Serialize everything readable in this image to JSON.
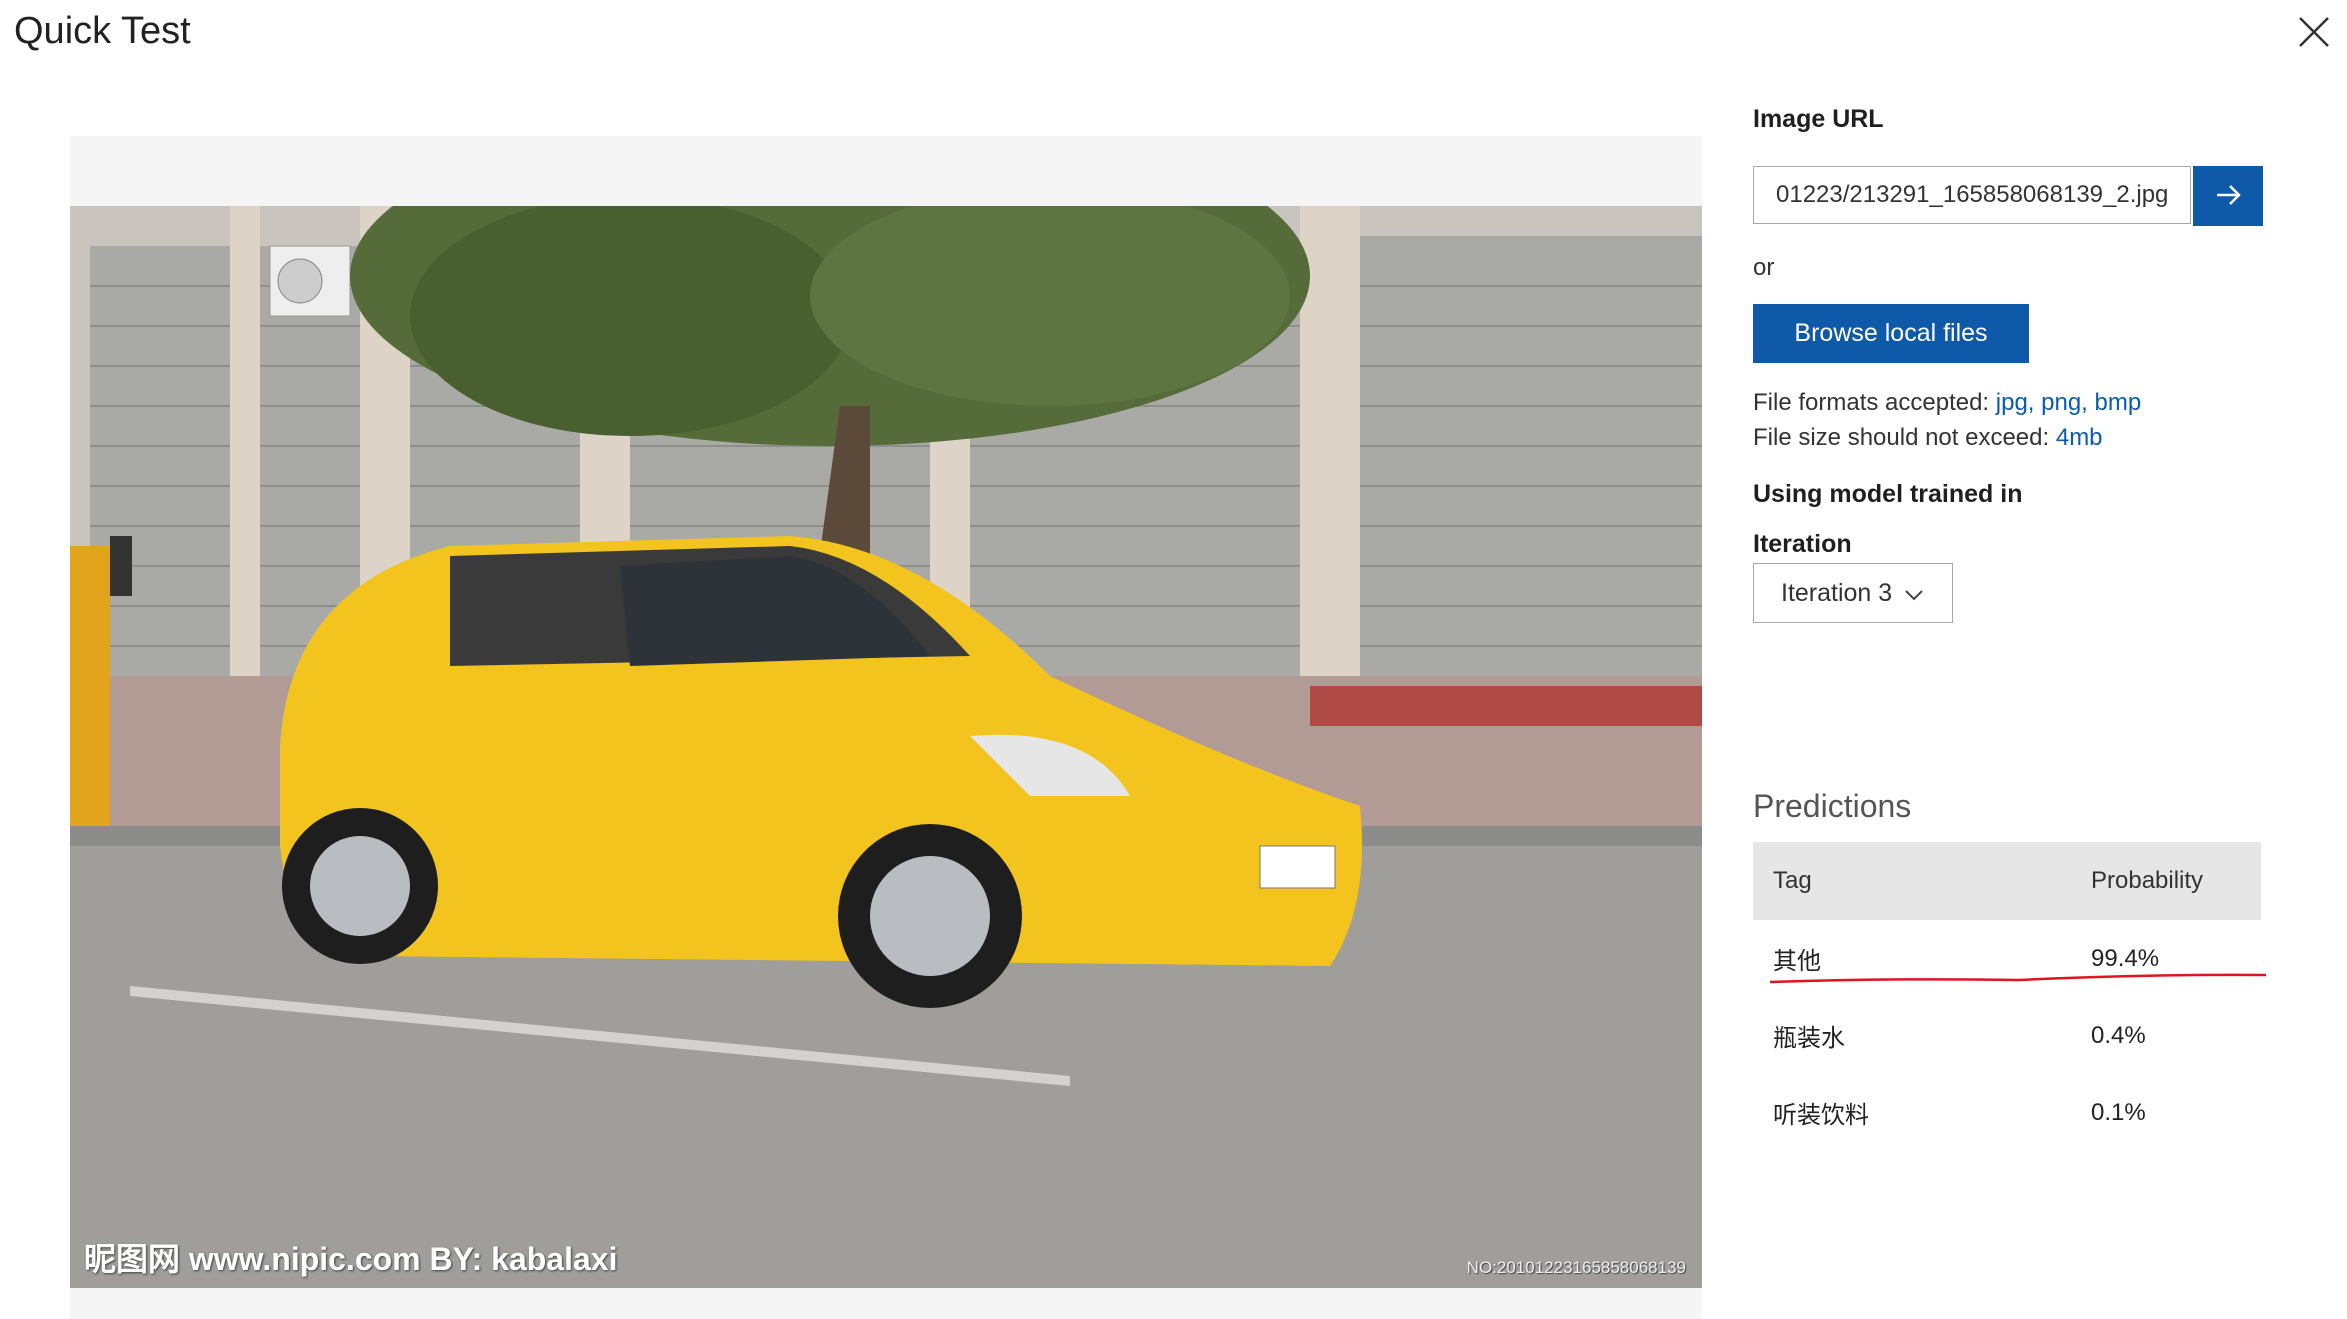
{
  "window": {
    "title": "Quick Test",
    "close_icon": "close-icon"
  },
  "preview": {
    "watermark_left": "昵图网 www.nipic.com   BY: kabalaxi",
    "watermark_right": "NO:20101223165858068139"
  },
  "panel": {
    "image_url_label": "Image URL",
    "image_url_value": "01223/213291_165858068139_2.jpg",
    "go_icon": "arrow-right-icon",
    "or_text": "or",
    "browse_label": "Browse local files",
    "formats_prefix": "File formats accepted: ",
    "formats_value": "jpg, png, bmp",
    "size_prefix": "File size should not exceed: ",
    "size_value": "4mb",
    "model_label": "Using model trained in",
    "iteration_label": "Iteration",
    "iteration_value": "Iteration 3"
  },
  "predictions": {
    "title": "Predictions",
    "col_tag": "Tag",
    "col_probability": "Probability",
    "rows": [
      {
        "tag": "其他",
        "probability": "99.4%"
      },
      {
        "tag": "瓶装水",
        "probability": "0.4%"
      },
      {
        "tag": "听装饮料",
        "probability": "0.1%"
      }
    ]
  },
  "colors": {
    "primary_button": "#0f5aa8",
    "link": "#0b5cad",
    "annotation_underline": "#e0141e",
    "table_header_bg": "#e6e6e6"
  }
}
